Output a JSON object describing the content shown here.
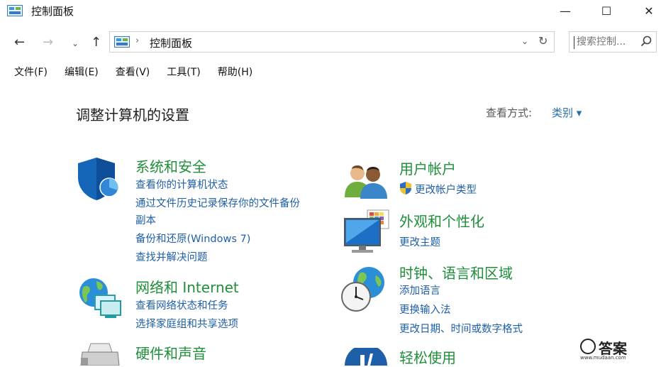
{
  "window": {
    "title": "控制面板",
    "minimize": "—",
    "maximize": "☐",
    "close": "✕"
  },
  "nav": {
    "back": "←",
    "forward": "→",
    "recent": "⌄",
    "up": "↑",
    "breadcrumb_sep": "›",
    "path": "控制面板",
    "dropdown": "⌄",
    "refresh": "↻",
    "search_placeholder": "搜索控制...",
    "search_icon": "⚲"
  },
  "menu": [
    "文件(F)",
    "编辑(E)",
    "查看(V)",
    "工具(T)",
    "帮助(H)"
  ],
  "main": {
    "heading": "调整计算机的设置",
    "view_by_label": "查看方式:",
    "view_by_value": "类别 ▾"
  },
  "categories": {
    "system_security": {
      "title": "系统和安全",
      "links": [
        "查看你的计算机状态",
        "通过文件历史记录保存你的文件备份",
        "副本",
        "备份和还原(Windows 7)",
        "查找并解决问题"
      ]
    },
    "network": {
      "title": "网络和 Internet",
      "links": [
        "查看网络状态和任务",
        "选择家庭组和共享选项"
      ]
    },
    "hardware": {
      "title": "硬件和声音"
    },
    "user_accounts": {
      "title": "用户帐户",
      "links": [
        "更改帐户类型"
      ]
    },
    "appearance": {
      "title": "外观和个性化",
      "links": [
        "更改主题"
      ]
    },
    "clock_region": {
      "title": "时钟、语言和区域",
      "links": [
        "添加语言",
        "更换输入法",
        "更改日期、时间或数字格式"
      ]
    },
    "ease_access": {
      "title": "轻松使用"
    }
  },
  "watermark": {
    "text": "答案",
    "url": "www.mudaan.com"
  },
  "colors": {
    "category_title": "#1f8f3a",
    "link": "#1f5fa8",
    "accent": "#2a6ea8"
  }
}
